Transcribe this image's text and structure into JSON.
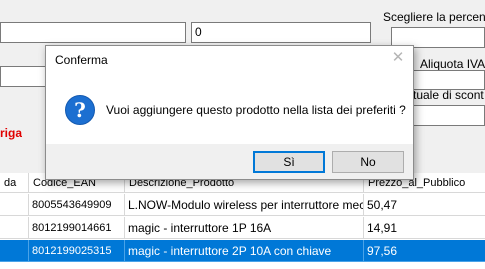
{
  "background_form": {
    "scegliere_label": "Scegliere la percentu",
    "number_field_value": "0",
    "aliquota_label": "Aliquota IVA",
    "sconto_label": "tuale di scont",
    "riga_label": "riga",
    "accent_red": "#e00000"
  },
  "grid": {
    "headers": [
      "da",
      "Codice_EAN",
      "Descrizione_Prodotto",
      "Prezzo_al_Pubblico"
    ],
    "rows": [
      {
        "code": "8005543649909",
        "desc": "L.NOW-Modulo wireless per interruttore mecc",
        "price": "50,47"
      },
      {
        "code": "8012199014661",
        "desc": "magic - interruttore 1P 16A",
        "price": "14,91"
      },
      {
        "code": "8012199025315",
        "desc": "magic - interruttore 2P 10A con chiave",
        "price": "97,56",
        "selected": true
      }
    ],
    "selection_color": "#0078d7"
  },
  "dialog": {
    "title": "Conferma",
    "close_symbol": "✕",
    "icon": "question-icon",
    "icon_glyph": "?",
    "message": "Vuoi aggiungere questo prodotto nella lista dei preferiti ?",
    "yes_label": "Sì",
    "no_label": "No"
  }
}
